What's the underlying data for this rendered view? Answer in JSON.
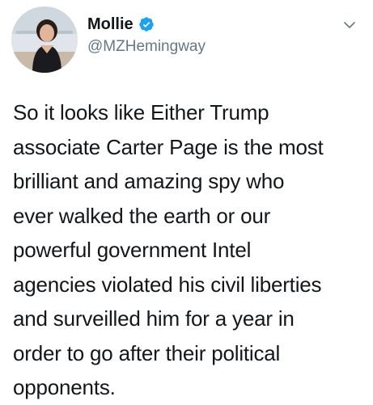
{
  "author": {
    "display_name": "Mollie",
    "handle": "@MZHemingway",
    "verified": true,
    "avatar_icon": "profile-photo",
    "verified_icon": "verified-badge-icon"
  },
  "menu": {
    "icon": "chevron-down-icon"
  },
  "tweet": {
    "text": "So it looks like Either Trump\nassociate Carter Page is the most\nbrilliant and amazing spy who\never walked the earth or our\npowerful government Intel\nagencies violated his civil liberties\nand surveilled him for a year in\norder to go after their political\nopponents."
  },
  "colors": {
    "verified_blue": "#1da1f2",
    "handle_gray": "#657786",
    "text": "#14171a"
  }
}
